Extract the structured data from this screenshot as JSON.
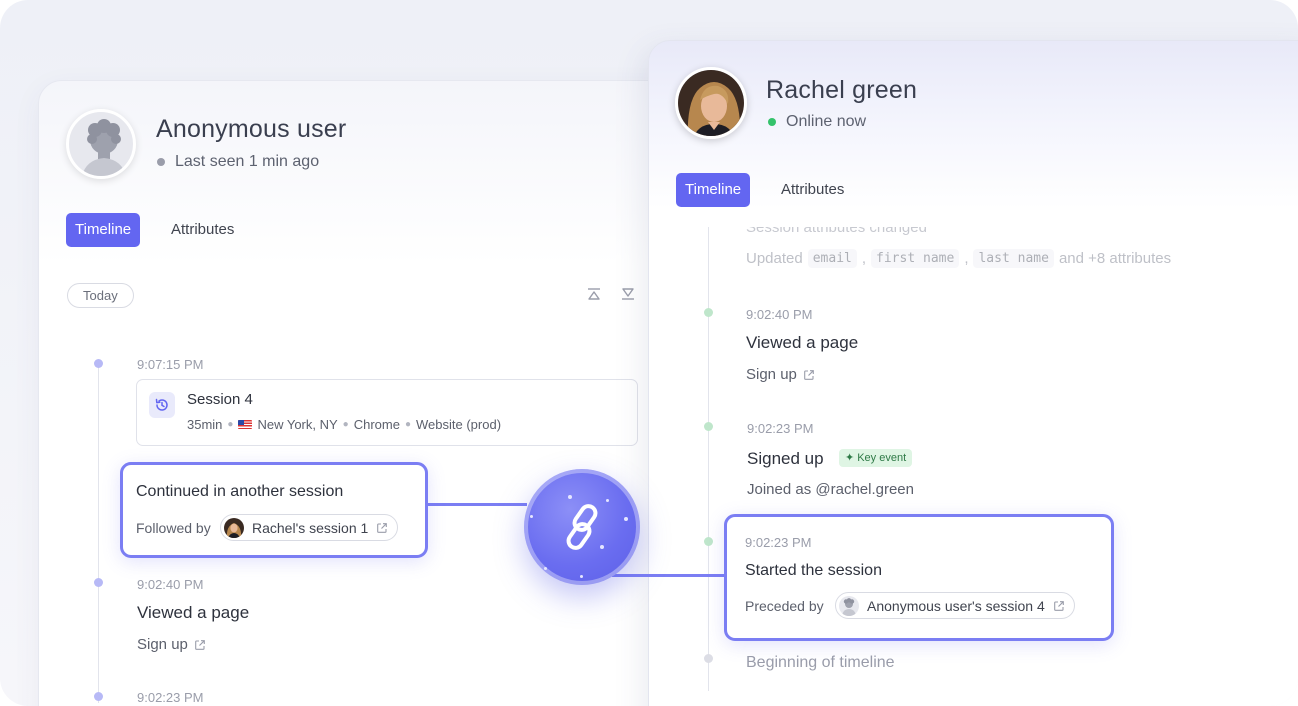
{
  "left_panel": {
    "user_name": "Anonymous user",
    "status": "Last seen 1 min ago",
    "status_color": "#9a9daa",
    "tabs": [
      {
        "label": "Timeline",
        "active": true
      },
      {
        "label": "Attributes",
        "active": false
      }
    ],
    "date_pill": "Today",
    "events": [
      {
        "time": "9:07:15 PM",
        "session": {
          "title": "Session 4",
          "duration": "35min",
          "location": "New York, NY",
          "browser": "Chrome",
          "source": "Website (prod)"
        }
      },
      {
        "title": "Continued in another session",
        "label": "Followed by",
        "link": "Rachel's session 1"
      },
      {
        "time": "9:02:40 PM",
        "title": "Viewed a page",
        "sub": "Sign up"
      },
      {
        "time": "9:02:23 PM"
      }
    ]
  },
  "right_panel": {
    "user_name": "Rachel green",
    "status": "Online now",
    "status_color": "#34c26b",
    "tabs": [
      {
        "label": "Timeline",
        "active": true
      },
      {
        "label": "Attributes",
        "active": false
      }
    ],
    "events": [
      {
        "title": "Session attributes changed",
        "updated_label": "Updated",
        "fields": [
          "email",
          "first name",
          "last name"
        ],
        "more": "and +8 attributes"
      },
      {
        "time": "9:02:40 PM",
        "title": "Viewed a page",
        "sub": "Sign up"
      },
      {
        "time": "9:02:23 PM",
        "title": "Signed up",
        "badge": "Key event",
        "sub": "Joined as @rachel.green"
      },
      {
        "time": "9:02:23 PM",
        "title": "Started the session",
        "label": "Preceded by",
        "link": "Anonymous user's session 4"
      },
      {
        "title": "Beginning of timeline"
      }
    ]
  },
  "colors": {
    "accent": "#6366f1",
    "highlight": "#7b7ef3",
    "key_event_bg": "#dff5e4"
  }
}
